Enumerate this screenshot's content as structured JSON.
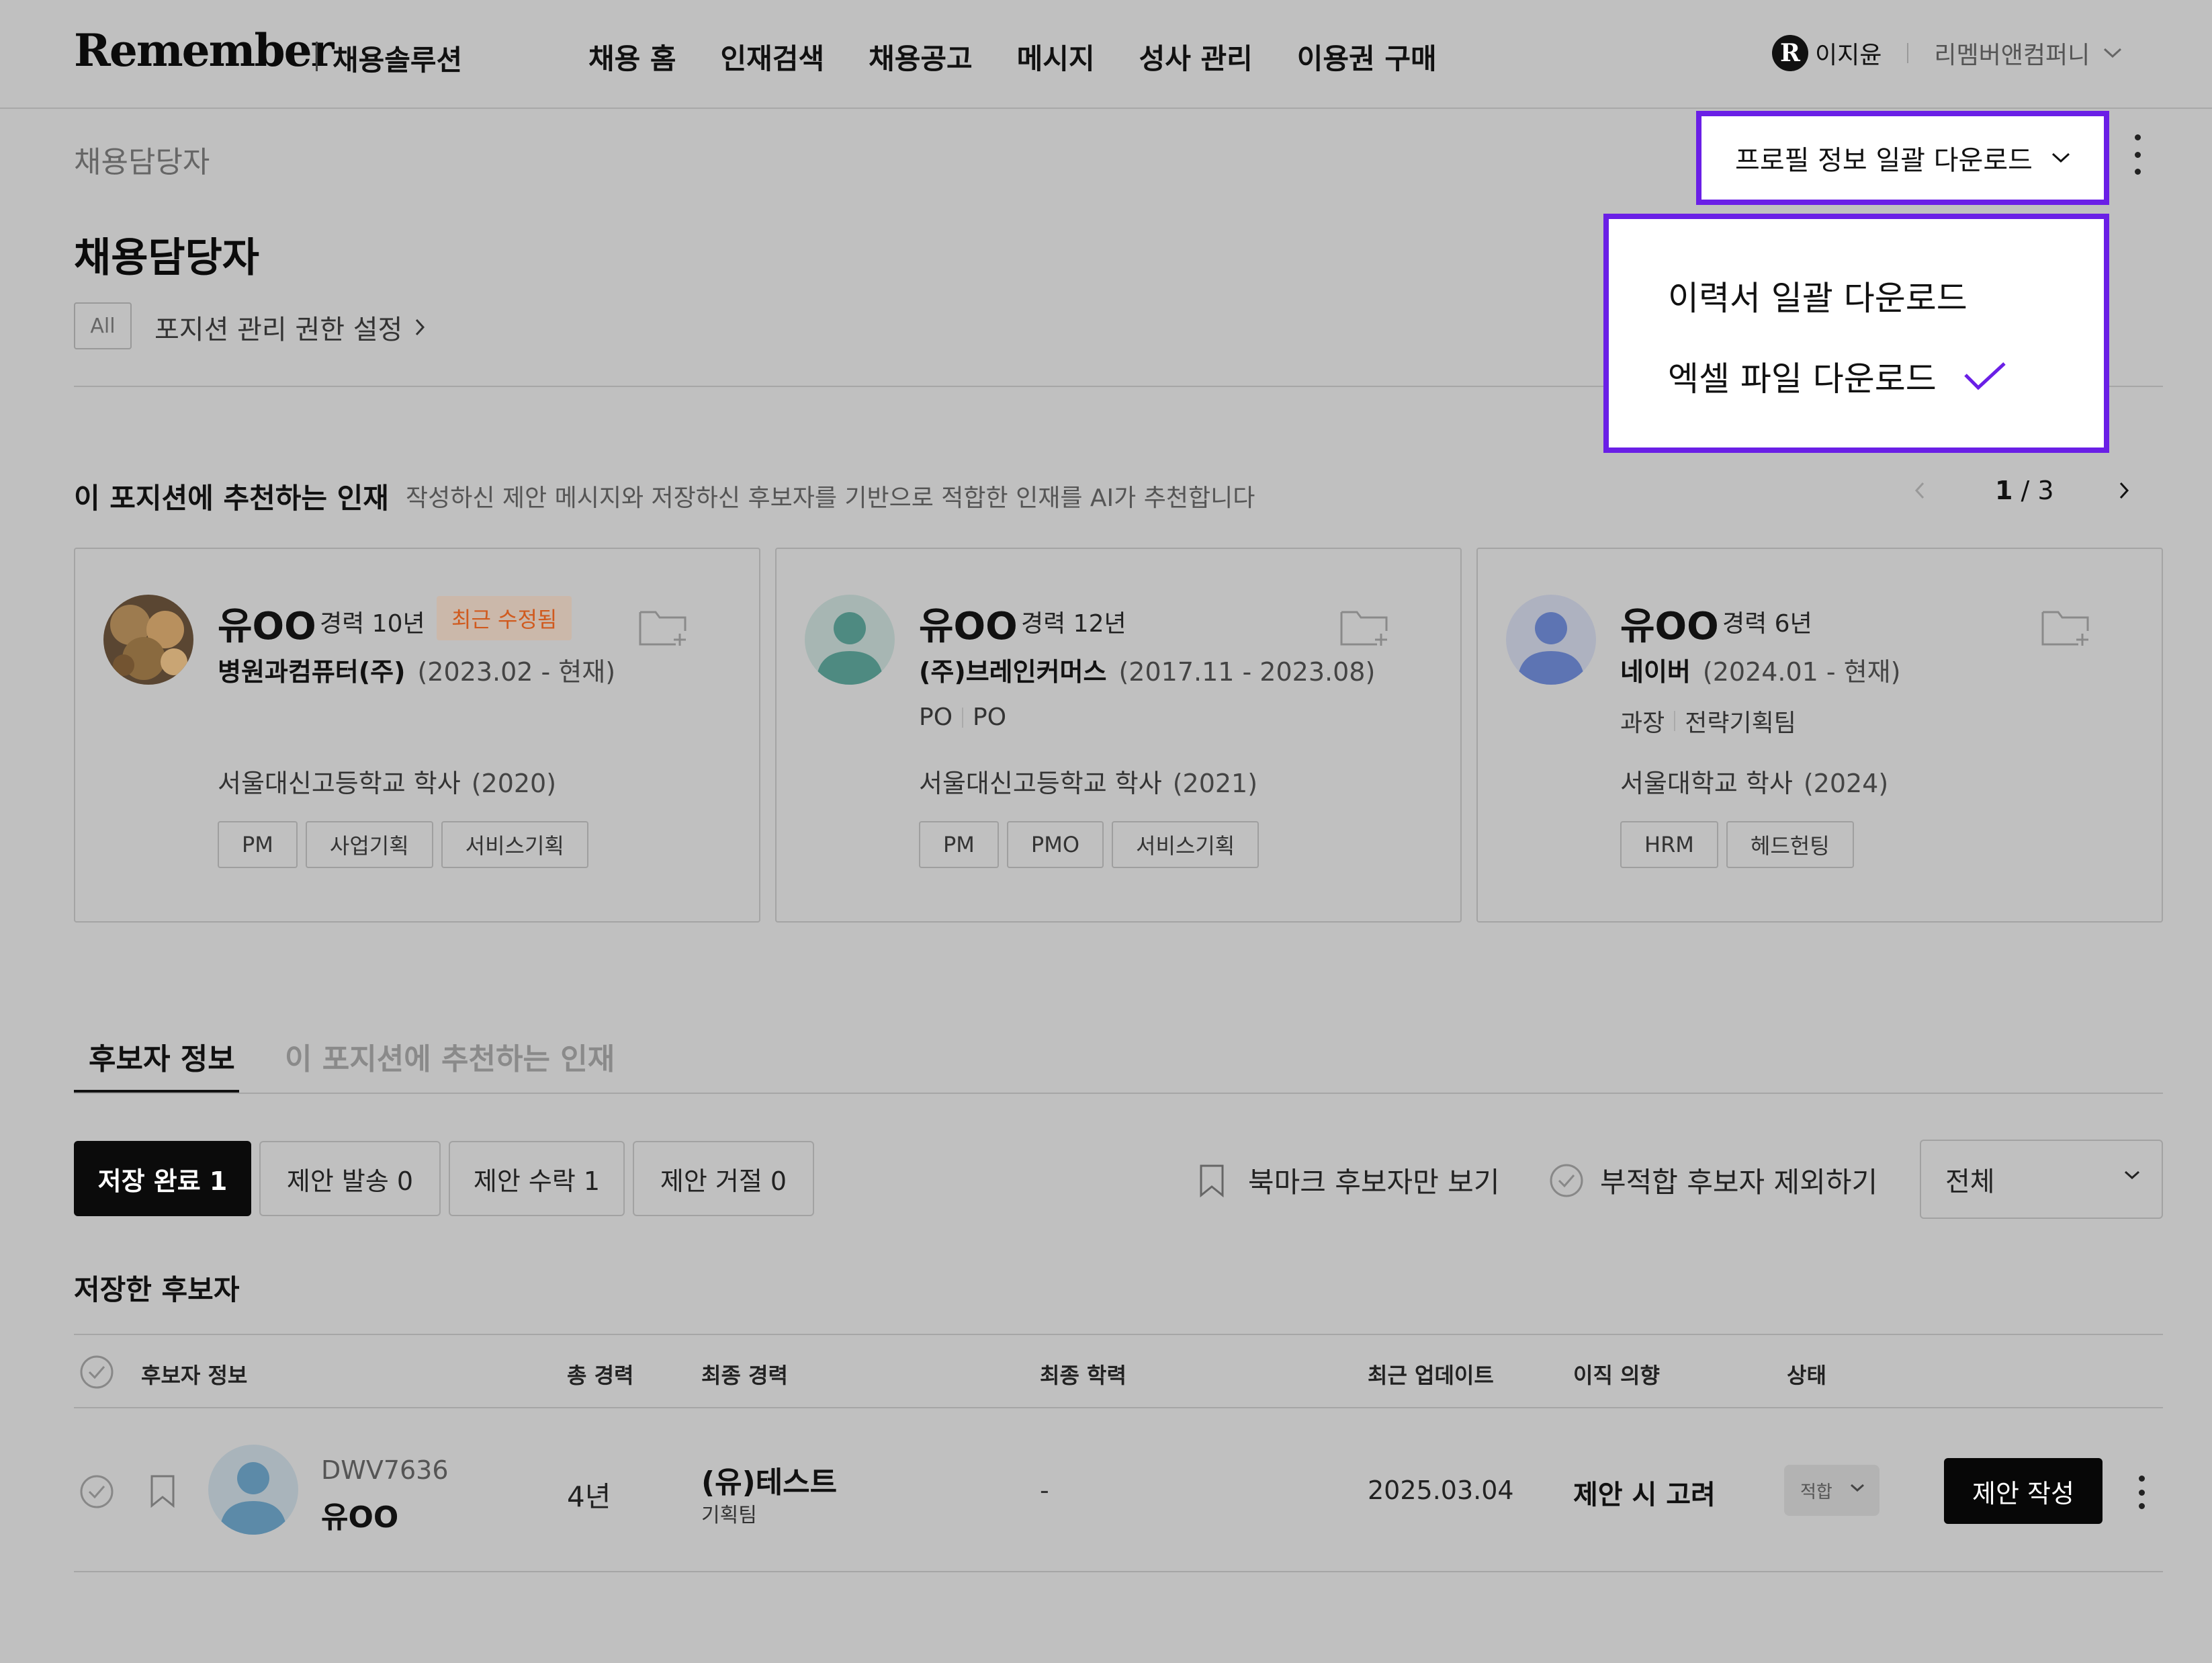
{
  "header": {
    "logo": "Remember",
    "logo_sub": "채용솔루션",
    "nav": [
      "채용 홈",
      "인재검색",
      "채용공고",
      "메시지",
      "성사 관리",
      "이용권 구매"
    ],
    "user_badge": "R",
    "user_name": "이지윤",
    "company": "리멤버앤컴퍼니"
  },
  "page": {
    "breadcrumb": "채용담당자",
    "title": "채용담당자",
    "all_badge": "All",
    "permission_link": "포지션 관리 권한 설정"
  },
  "download": {
    "button_label": "프로필 정보 일괄 다운로드",
    "options": [
      "이력서 일괄 다운로드",
      "엑셀 파일 다운로드"
    ],
    "selected_option": "엑셀 파일 다운로드",
    "accent_color": "#6a1fe6"
  },
  "recommend": {
    "title": "이 포지션에 추천하는 인재",
    "desc": "작성하신 제안 메시지와 저장하신 후보자를 기반으로 적합한 인재를 AI가 추천합니다",
    "page_current": "1",
    "page_sep": " / ",
    "page_total": "3",
    "cards": [
      {
        "name": "유OO",
        "experience": "경력 10년",
        "badge": "최근 수정됨",
        "company": "병원과컴퓨터(주)",
        "period": "(2023.02 - 현재)",
        "role": "",
        "dept": "",
        "school": "서울대신고등학교 학사",
        "school_year": "(2020)",
        "skills": [
          "PM",
          "사업기획",
          "서비스기획"
        ]
      },
      {
        "name": "유OO",
        "experience": "경력 12년",
        "badge": "",
        "company": "(주)브레인커머스",
        "period": "(2017.11 - 2023.08)",
        "role": "PO",
        "dept": "PO",
        "school": "서울대신고등학교 학사",
        "school_year": "(2021)",
        "skills": [
          "PM",
          "PMO",
          "서비스기획"
        ]
      },
      {
        "name": "유OO",
        "experience": "경력 6년",
        "badge": "",
        "company": "네이버",
        "period": "(2024.01 - 현재)",
        "role": "과장",
        "dept": "전략기획팀",
        "school": "서울대학교 학사",
        "school_year": "(2024)",
        "skills": [
          "HRM",
          "헤드헌팅"
        ]
      }
    ]
  },
  "tabs": [
    "후보자 정보",
    "이 포지션에 추천하는 인재"
  ],
  "filters": {
    "buttons": [
      "저장 완료 1",
      "제안 발송 0",
      "제안 수락 1",
      "제안 거절 0"
    ],
    "bookmark_only": "북마크 후보자만 보기",
    "exclude_unfit": "부적합 후보자 제외하기",
    "select_value": "전체"
  },
  "table": {
    "title": "저장한 후보자",
    "headers": [
      "후보자 정보",
      "총 경력",
      "최종 경력",
      "최종 학력",
      "최근 업데이트",
      "이직 의향",
      "상태"
    ],
    "rows": [
      {
        "id": "DWV7636",
        "name": "유OO",
        "total_experience": "4년",
        "last_company": "(유)테스트",
        "last_team": "기획팀",
        "education": "-",
        "updated": "2025.03.04",
        "intent": "제안 시 고려",
        "status": "적합",
        "action": "제안 작성"
      }
    ]
  }
}
